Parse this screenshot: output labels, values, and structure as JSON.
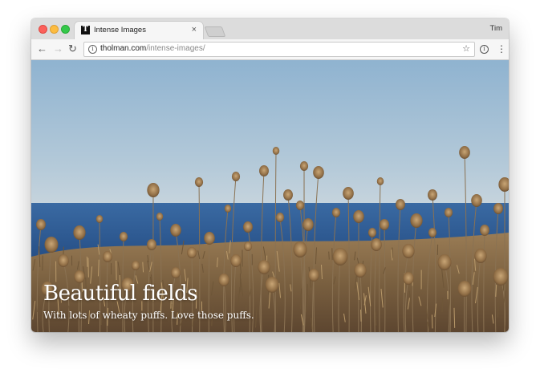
{
  "window": {
    "controls": [
      "close-icon",
      "minimize-icon",
      "maximize-icon"
    ],
    "profile_name": "Tim"
  },
  "tab": {
    "favicon_letter": "T",
    "title": "Intense Images",
    "close_glyph": "×"
  },
  "toolbar": {
    "back_glyph": "←",
    "forward_glyph": "→",
    "reload_glyph": "↻",
    "info_glyph": "i",
    "url_host": "tholman.com",
    "url_path": "/intense-images/",
    "star_glyph": "☆",
    "extension_glyph": "i",
    "menu_glyph": "⋮"
  },
  "hero": {
    "title": "Beautiful fields",
    "subtitle": "With lots of wheaty puffs. Love those puffs."
  },
  "colors": {
    "sky_top": "#93b6d2",
    "sky_horizon": "#c3d3de",
    "sea": "#2f5f99",
    "field": "#8b6f4a"
  }
}
